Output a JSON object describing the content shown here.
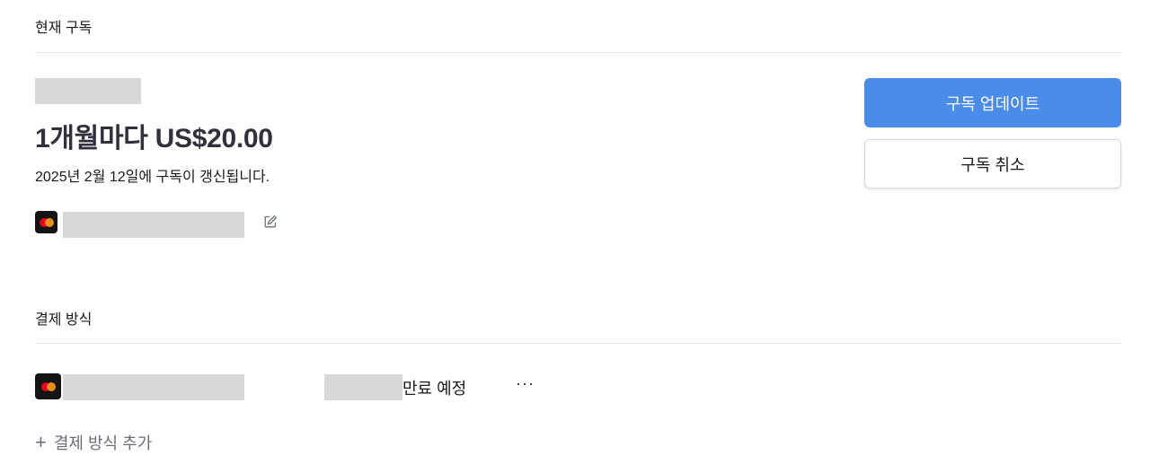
{
  "current_subscription": {
    "section_title": "현재 구독",
    "price_line": "1개월마다 US$20.00",
    "renewal_text": "2025년 2월 12일에 구독이 갱신됩니다.",
    "update_button": "구독 업데이트",
    "cancel_button": "구독 취소",
    "card_icon": "mastercard-icon",
    "edit_icon": "edit-icon"
  },
  "payment_methods": {
    "section_title": "결제 방식",
    "items": [
      {
        "card_icon": "mastercard-icon",
        "status": "만료 예정",
        "more_label": "···"
      }
    ],
    "add_label": "결제 방식 추가",
    "add_icon": "plus-icon"
  },
  "colors": {
    "primary_button": "#4a8cea",
    "divider": "#e3e5e8",
    "redacted": "#d8d8d8"
  }
}
